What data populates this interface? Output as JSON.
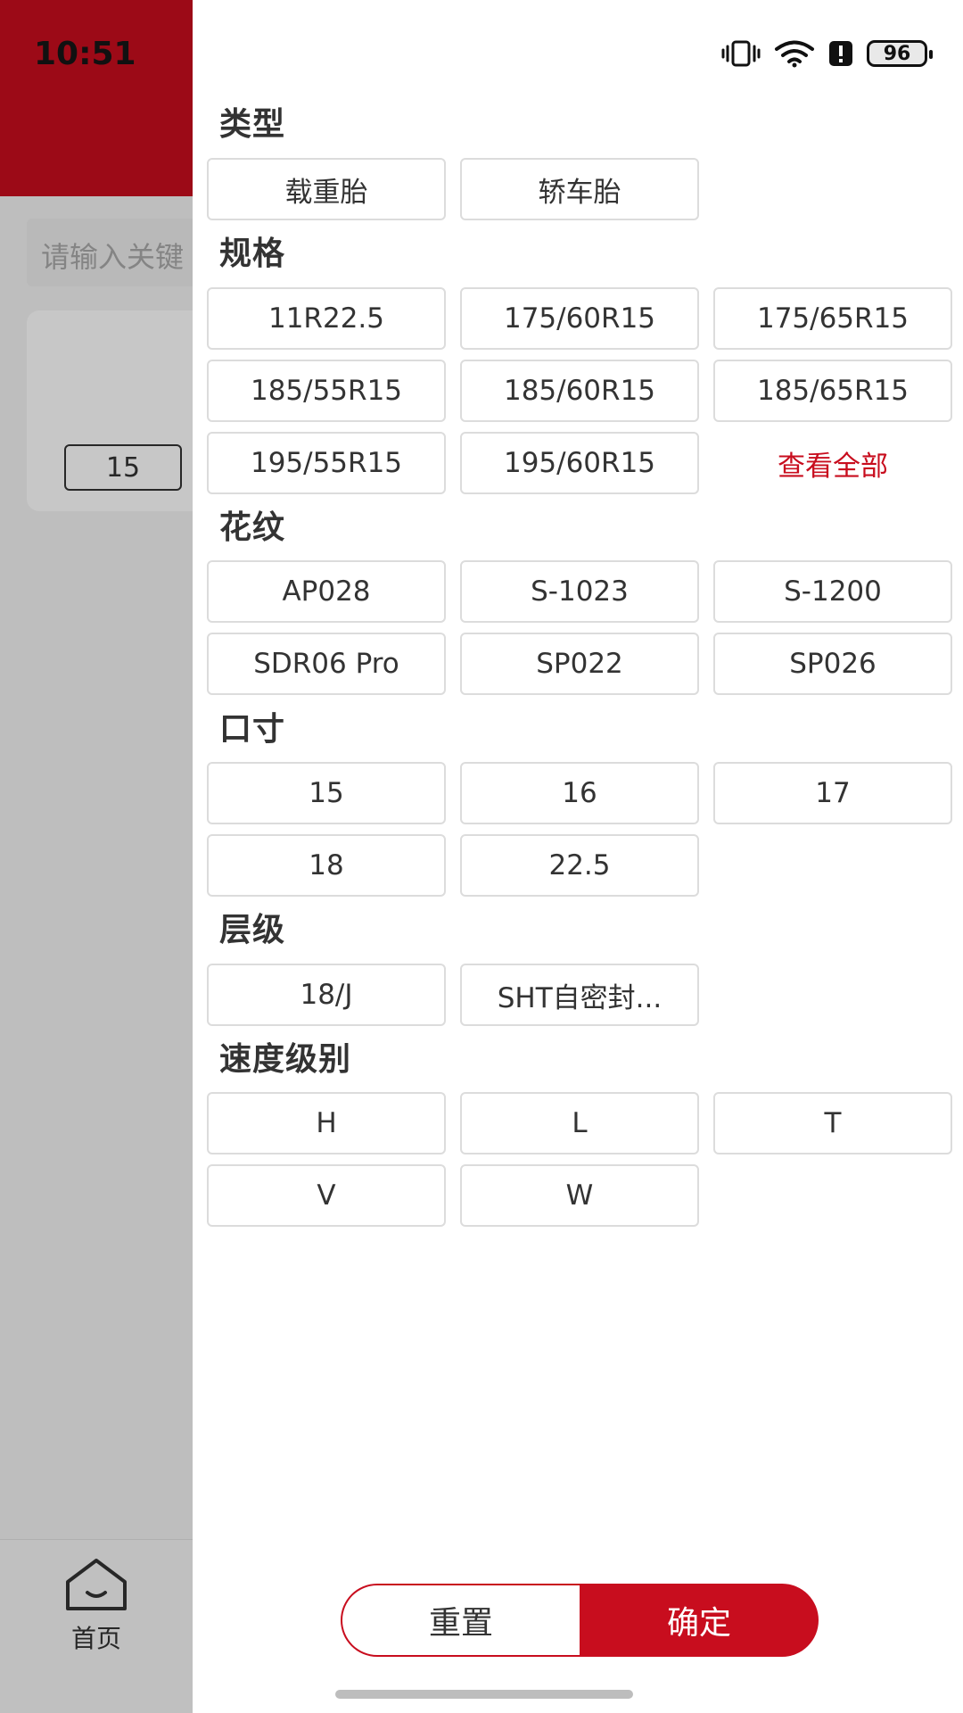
{
  "status_bar": {
    "time": "10:51",
    "battery": "96"
  },
  "background": {
    "search_placeholder": "请输入关键",
    "card_tag": "15",
    "tab_home_label": "首页"
  },
  "filters": {
    "type": {
      "title": "类型",
      "options": [
        "载重胎",
        "轿车胎"
      ]
    },
    "spec": {
      "title": "规格",
      "options": [
        "11R22.5",
        "175/60R15",
        "175/65R15",
        "185/55R15",
        "185/60R15",
        "185/65R15",
        "195/55R15",
        "195/60R15"
      ],
      "view_all": "查看全部"
    },
    "pattern": {
      "title": "花纹",
      "options": [
        "AP028",
        "S-1023",
        "S-1200",
        "SDR06 Pro",
        "SP022",
        "SP026"
      ]
    },
    "size": {
      "title": "口寸",
      "options": [
        "15",
        "16",
        "17",
        "18",
        "22.5"
      ]
    },
    "ply": {
      "title": "层级",
      "options": [
        "18/J",
        "SHT自密封..."
      ]
    },
    "speed": {
      "title": "速度级别",
      "options": [
        "H",
        "L",
        "T",
        "V",
        "W"
      ]
    }
  },
  "actions": {
    "reset": "重置",
    "confirm": "确定"
  },
  "colors": {
    "accent": "#c80d1e"
  }
}
